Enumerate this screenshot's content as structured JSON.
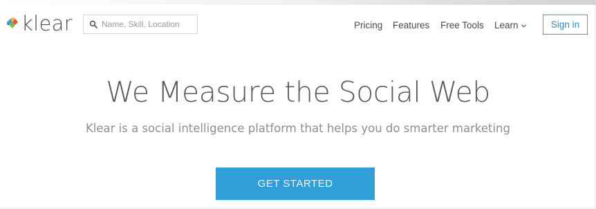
{
  "brand": {
    "name": "klear",
    "logo_colors": [
      "#3a9fd6",
      "#e0533a",
      "#7fbf3f",
      "#f2b632",
      "#2b2b2b"
    ]
  },
  "search": {
    "placeholder": "Name, Skill, Location",
    "value": "",
    "icon": "search-icon"
  },
  "nav": {
    "items": [
      {
        "label": "Pricing"
      },
      {
        "label": "Features"
      },
      {
        "label": "Free Tools"
      },
      {
        "label": "Learn",
        "icon": "chevron-down-icon"
      }
    ]
  },
  "header": {
    "signin_label": "Sign in"
  },
  "hero": {
    "title": "We Measure the Social Web",
    "subtitle": "Klear is a social intelligence platform that helps you do smarter marketing",
    "cta_label": "GET STARTED"
  },
  "colors": {
    "accent": "#2f9ed9",
    "text": "#5a5a5a",
    "muted": "#8e8e8e"
  }
}
